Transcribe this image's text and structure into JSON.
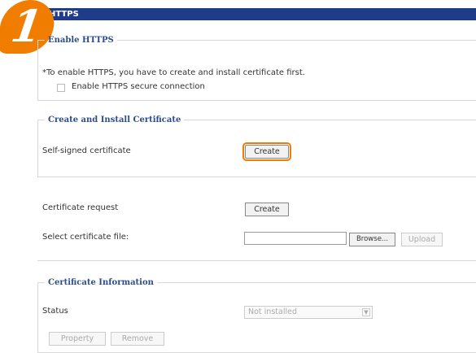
{
  "header": {
    "title": "HTTPS",
    "step_number": "1"
  },
  "enable_https": {
    "legend": "Enable HTTPS",
    "note": "*To enable HTTPS, you have to create and install certificate first.",
    "checkbox_label": "Enable HTTPS secure connection",
    "checked": false
  },
  "create_install": {
    "legend": "Create and Install Certificate",
    "self_signed_label": "Self-signed certificate",
    "self_signed_button": "Create",
    "cert_request_label": "Certificate request",
    "cert_request_button": "Create",
    "select_file_label": "Select certificate file:",
    "file_value": "",
    "browse_button": "Browse...",
    "upload_button": "Upload"
  },
  "cert_info": {
    "legend": "Certificate Information",
    "status_label": "Status",
    "status_value": "Not installed",
    "properties_button": "Property",
    "remove_button": "Remove"
  },
  "colors": {
    "header_bg": "#1f3c8a",
    "highlight": "#f07d00",
    "legend": "#2c4c8c"
  }
}
